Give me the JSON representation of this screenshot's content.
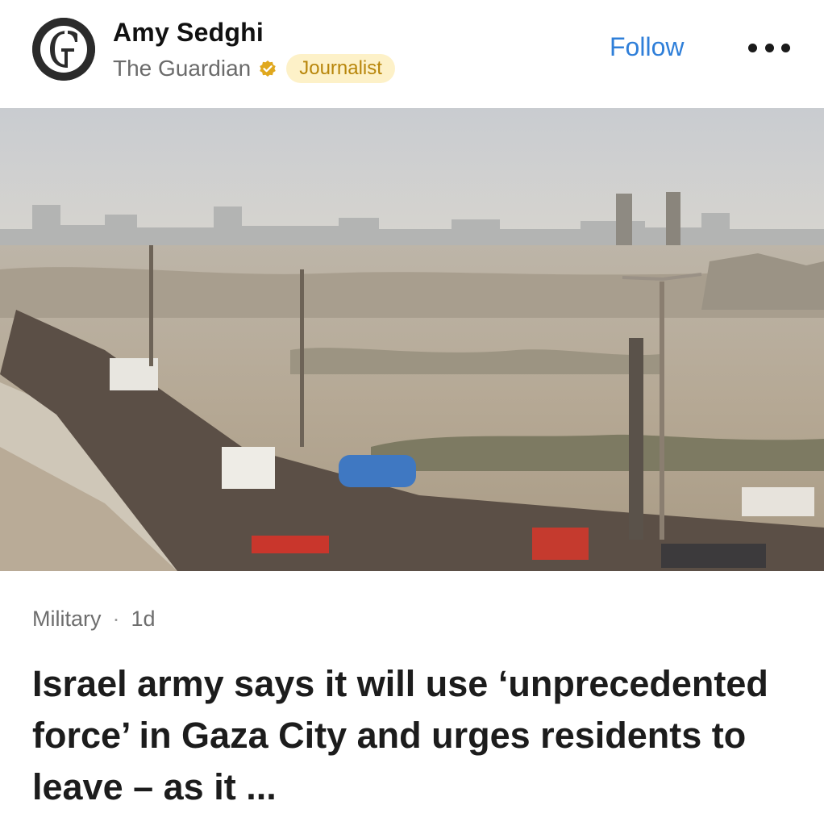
{
  "author": {
    "name": "Amy Sedghi",
    "publisher": "The Guardian",
    "role_badge": "Journalist",
    "avatar_icon": "guardian-g-logo",
    "verified_icon": "verified-badge-icon"
  },
  "actions": {
    "follow_label": "Follow",
    "more_icon": "more-dots-icon"
  },
  "colors": {
    "follow": "#2f7fd9",
    "badge_bg": "#fdf1c8",
    "badge_text": "#b8860b",
    "verified": "#e0a81e"
  },
  "article": {
    "category": "Military",
    "separator": "·",
    "age": "1d",
    "headline": "Israel army says it will use ‘unprecedented force’ in Gaza City and urges residents to leave – as it ..."
  }
}
